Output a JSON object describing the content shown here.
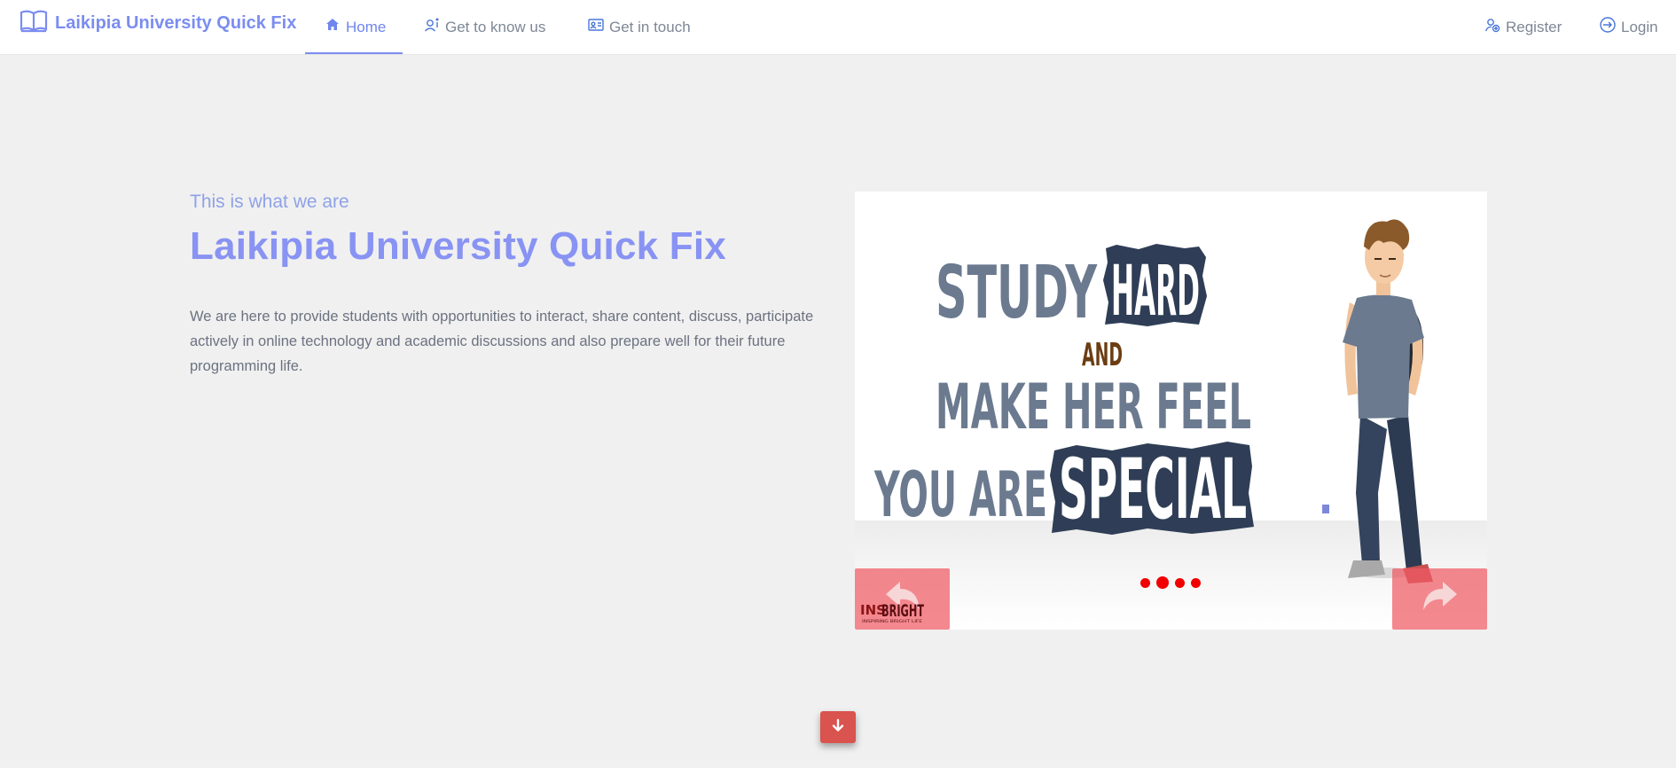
{
  "navbar": {
    "brand": "Laikipia University Quick Fix",
    "items": [
      {
        "label": "Home",
        "icon": "home-icon",
        "active": true
      },
      {
        "label": "Get to know us",
        "icon": "person-info-icon",
        "active": false
      },
      {
        "label": "Get in touch",
        "icon": "contact-card-icon",
        "active": false
      }
    ],
    "right_items": [
      {
        "label": "Register",
        "icon": "person-add-icon"
      },
      {
        "label": "Login",
        "icon": "login-icon"
      }
    ]
  },
  "hero": {
    "subtitle": "This is what we are",
    "title": "Laikipia University Quick Fix",
    "description": "We are here to provide students with opportunities to interact, share content, discuss, participate actively in online technology and academic discussions and also prepare well for their future programming life."
  },
  "carousel": {
    "poster_lines": [
      "STUDY",
      "HARD",
      "AND",
      "MAKE HER FEEL",
      "YOU ARE",
      "SPECIAL"
    ],
    "watermark": {
      "line1": "INS",
      "line2": "BRIGHT",
      "tagline": "INSPIRING BRIGHT LIFE"
    },
    "slide_count": 4,
    "active_slide": 2,
    "prev_icon": "arrow-back-icon",
    "next_icon": "arrow-forward-icon"
  },
  "scroll_button": {
    "icon": "arrow-down-icon"
  },
  "colors": {
    "brand": "#7b8df0",
    "title": "#8893f3",
    "subtitle": "#8fa2e8",
    "accent_red": "#d9534f",
    "dot_red": "#f20000",
    "poster_gray": "#6b7a8f",
    "poster_navy": "#2f3e56",
    "poster_brown": "#6b3d12"
  }
}
